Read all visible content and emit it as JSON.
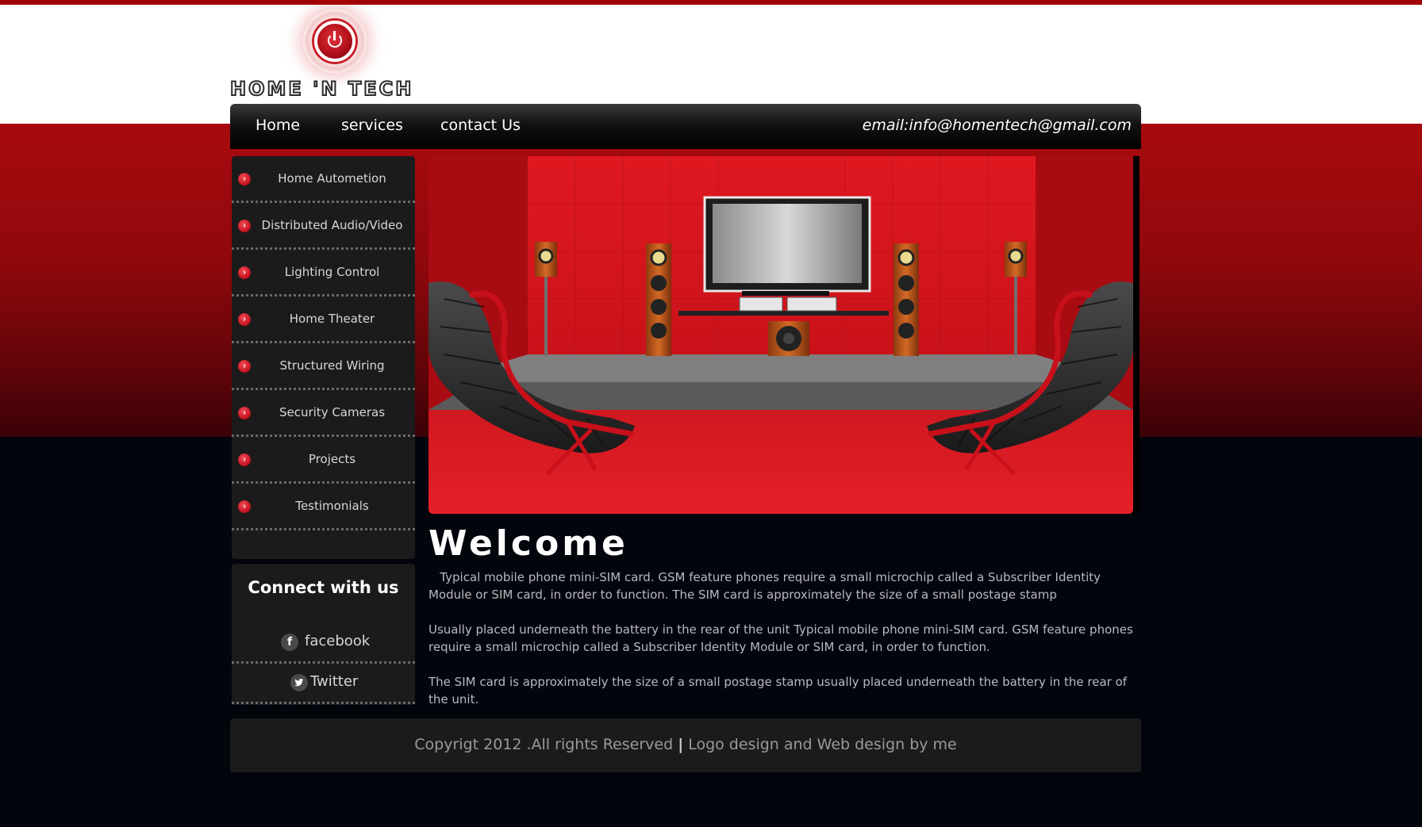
{
  "colors": {
    "brand_red": "#a80a0e",
    "nav_black": "#000000",
    "panel": "#1b1b1c",
    "page_dark": "#03050d",
    "bullet_red": "#c2101c"
  },
  "logo": {
    "text": "HOME 'N TECH",
    "icon": "power-icon"
  },
  "nav": {
    "items": [
      "Home",
      "services",
      "contact Us"
    ],
    "email": "email:info@homentech@gmail.com"
  },
  "sidebar": {
    "bullet_icon": "chevron-right-icon",
    "items": [
      "Home Autometion",
      "Distributed Audio/Video",
      "Lighting Control",
      "Home Theater",
      "Structured Wiring",
      "Security Cameras",
      "Projects",
      "Testimonials"
    ]
  },
  "connect": {
    "title": "Connect with us",
    "links": [
      {
        "icon": "facebook-icon",
        "glyph": "f",
        "label": "facebook"
      },
      {
        "icon": "twitter-icon",
        "glyph": "•",
        "label": "Twitter"
      }
    ]
  },
  "main": {
    "title": "Welcome",
    "paragraphs": [
      "   Typical mobile phone mini-SIM card. GSM feature phones require a small microchip called a Subscriber Identity Module or SIM card, in order to function. The SIM card is approximately the size of a small postage stamp",
      "Usually placed underneath the battery in the rear of the unit Typical mobile phone mini-SIM card. GSM feature phones require a small microchip called a Subscriber Identity Module or SIM card, in order to function.",
      "The SIM card is approximately the size of a small postage stamp usually placed underneath the battery in the rear of the unit."
    ]
  },
  "footer": {
    "left": "Copyrigt 2012 .All rights Reserved",
    "separator": "|",
    "right": "Logo design and Web design by me"
  }
}
